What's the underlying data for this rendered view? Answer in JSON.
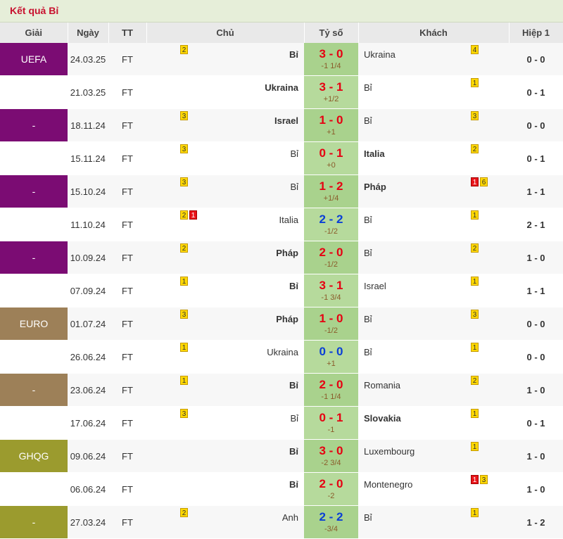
{
  "title": "Kết quả Bỉ",
  "columns": [
    "Giải",
    "Ngày",
    "TT",
    "Chủ",
    "Tỷ số",
    "Khách",
    "Hiệp 1"
  ],
  "rows": [
    {
      "league": "UEFA",
      "league_class": "lg-uefa",
      "date": "24.03.25",
      "tt": "FT",
      "home": "Bỉ",
      "home_bold": true,
      "home_cards": [
        {
          "t": "y",
          "n": "2"
        }
      ],
      "score": "3 - 0",
      "score_color": "red",
      "hcp": "-1 1/4",
      "away": "Ukraina",
      "away_bold": false,
      "away_cards": [
        {
          "t": "y",
          "n": "4"
        }
      ],
      "ht": "0 - 0"
    },
    {
      "league": "-",
      "league_class": "lg-uefa",
      "date": "21.03.25",
      "tt": "FT",
      "home": "Ukraina",
      "home_bold": true,
      "home_cards": [],
      "score": "3 - 1",
      "score_color": "red",
      "hcp": "+1/2",
      "away": "Bỉ",
      "away_bold": false,
      "away_cards": [
        {
          "t": "y",
          "n": "1"
        }
      ],
      "ht": "0 - 1"
    },
    {
      "league": "-",
      "league_class": "lg-uefa",
      "date": "18.11.24",
      "tt": "FT",
      "home": "Israel",
      "home_bold": true,
      "home_cards": [
        {
          "t": "y",
          "n": "3"
        }
      ],
      "score": "1 - 0",
      "score_color": "red",
      "hcp": "+1",
      "away": "Bỉ",
      "away_bold": false,
      "away_cards": [
        {
          "t": "y",
          "n": "3"
        }
      ],
      "ht": "0 - 0"
    },
    {
      "league": "-",
      "league_class": "lg-uefa",
      "date": "15.11.24",
      "tt": "FT",
      "home": "Bỉ",
      "home_bold": false,
      "home_cards": [
        {
          "t": "y",
          "n": "3"
        }
      ],
      "score": "0 - 1",
      "score_color": "red",
      "hcp": "+0",
      "away": "Italia",
      "away_bold": true,
      "away_cards": [
        {
          "t": "y",
          "n": "2"
        }
      ],
      "ht": "0 - 1"
    },
    {
      "league": "-",
      "league_class": "lg-uefa",
      "date": "15.10.24",
      "tt": "FT",
      "home": "Bỉ",
      "home_bold": false,
      "home_cards": [
        {
          "t": "y",
          "n": "3"
        }
      ],
      "score": "1 - 2",
      "score_color": "red",
      "hcp": "+1/4",
      "away": "Pháp",
      "away_bold": true,
      "away_cards": [
        {
          "t": "r",
          "n": "1"
        },
        {
          "t": "y",
          "n": "6"
        }
      ],
      "ht": "1 - 1"
    },
    {
      "league": "-",
      "league_class": "lg-uefa",
      "date": "11.10.24",
      "tt": "FT",
      "home": "Italia",
      "home_bold": false,
      "home_cards": [
        {
          "t": "y",
          "n": "2"
        },
        {
          "t": "r",
          "n": "1"
        }
      ],
      "score": "2 - 2",
      "score_color": "blue",
      "hcp": "-1/2",
      "away": "Bỉ",
      "away_bold": false,
      "away_cards": [
        {
          "t": "y",
          "n": "1"
        }
      ],
      "ht": "2 - 1"
    },
    {
      "league": "-",
      "league_class": "lg-uefa",
      "date": "10.09.24",
      "tt": "FT",
      "home": "Pháp",
      "home_bold": true,
      "home_cards": [
        {
          "t": "y",
          "n": "2"
        }
      ],
      "score": "2 - 0",
      "score_color": "red",
      "hcp": "-1/2",
      "away": "Bỉ",
      "away_bold": false,
      "away_cards": [
        {
          "t": "y",
          "n": "2"
        }
      ],
      "ht": "1 - 0"
    },
    {
      "league": "-",
      "league_class": "lg-uefa",
      "date": "07.09.24",
      "tt": "FT",
      "home": "Bỉ",
      "home_bold": true,
      "home_cards": [
        {
          "t": "y",
          "n": "1"
        }
      ],
      "score": "3 - 1",
      "score_color": "red",
      "hcp": "-1 3/4",
      "away": "Israel",
      "away_bold": false,
      "away_cards": [
        {
          "t": "y",
          "n": "1"
        }
      ],
      "ht": "1 - 1"
    },
    {
      "league": "EURO",
      "league_class": "lg-euro",
      "date": "01.07.24",
      "tt": "FT",
      "home": "Pháp",
      "home_bold": true,
      "home_cards": [
        {
          "t": "y",
          "n": "3"
        }
      ],
      "score": "1 - 0",
      "score_color": "red",
      "hcp": "-1/2",
      "away": "Bỉ",
      "away_bold": false,
      "away_cards": [
        {
          "t": "y",
          "n": "3"
        }
      ],
      "ht": "0 - 0"
    },
    {
      "league": "-",
      "league_class": "lg-euro",
      "date": "26.06.24",
      "tt": "FT",
      "home": "Ukraina",
      "home_bold": false,
      "home_cards": [
        {
          "t": "y",
          "n": "1"
        }
      ],
      "score": "0 - 0",
      "score_color": "blue",
      "hcp": "+1",
      "away": "Bỉ",
      "away_bold": false,
      "away_cards": [
        {
          "t": "y",
          "n": "1"
        }
      ],
      "ht": "0 - 0"
    },
    {
      "league": "-",
      "league_class": "lg-euro",
      "date": "23.06.24",
      "tt": "FT",
      "home": "Bỉ",
      "home_bold": true,
      "home_cards": [
        {
          "t": "y",
          "n": "1"
        }
      ],
      "score": "2 - 0",
      "score_color": "red",
      "hcp": "-1 1/4",
      "away": "Romania",
      "away_bold": false,
      "away_cards": [
        {
          "t": "y",
          "n": "2"
        }
      ],
      "ht": "1 - 0"
    },
    {
      "league": "-",
      "league_class": "lg-euro",
      "date": "17.06.24",
      "tt": "FT",
      "home": "Bỉ",
      "home_bold": false,
      "home_cards": [
        {
          "t": "y",
          "n": "3"
        }
      ],
      "score": "0 - 1",
      "score_color": "red",
      "hcp": "-1",
      "away": "Slovakia",
      "away_bold": true,
      "away_cards": [
        {
          "t": "y",
          "n": "1"
        }
      ],
      "ht": "0 - 1"
    },
    {
      "league": "GHQG",
      "league_class": "lg-ghqg",
      "date": "09.06.24",
      "tt": "FT",
      "home": "Bỉ",
      "home_bold": true,
      "home_cards": [],
      "score": "3 - 0",
      "score_color": "red",
      "hcp": "-2 3/4",
      "away": "Luxembourg",
      "away_bold": false,
      "away_cards": [
        {
          "t": "y",
          "n": "1"
        }
      ],
      "ht": "1 - 0"
    },
    {
      "league": "-",
      "league_class": "lg-ghqg",
      "date": "06.06.24",
      "tt": "FT",
      "home": "Bỉ",
      "home_bold": true,
      "home_cards": [],
      "score": "2 - 0",
      "score_color": "red",
      "hcp": "-2",
      "away": "Montenegro",
      "away_bold": false,
      "away_cards": [
        {
          "t": "r",
          "n": "1"
        },
        {
          "t": "y",
          "n": "3"
        }
      ],
      "ht": "1 - 0"
    },
    {
      "league": "-",
      "league_class": "lg-ghqg",
      "date": "27.03.24",
      "tt": "FT",
      "home": "Anh",
      "home_bold": false,
      "home_cards": [
        {
          "t": "y",
          "n": "2"
        }
      ],
      "score": "2 - 2",
      "score_color": "blue",
      "hcp": "-3/4",
      "away": "Bỉ",
      "away_bold": false,
      "away_cards": [
        {
          "t": "y",
          "n": "1"
        }
      ],
      "ht": "1 - 2"
    }
  ]
}
